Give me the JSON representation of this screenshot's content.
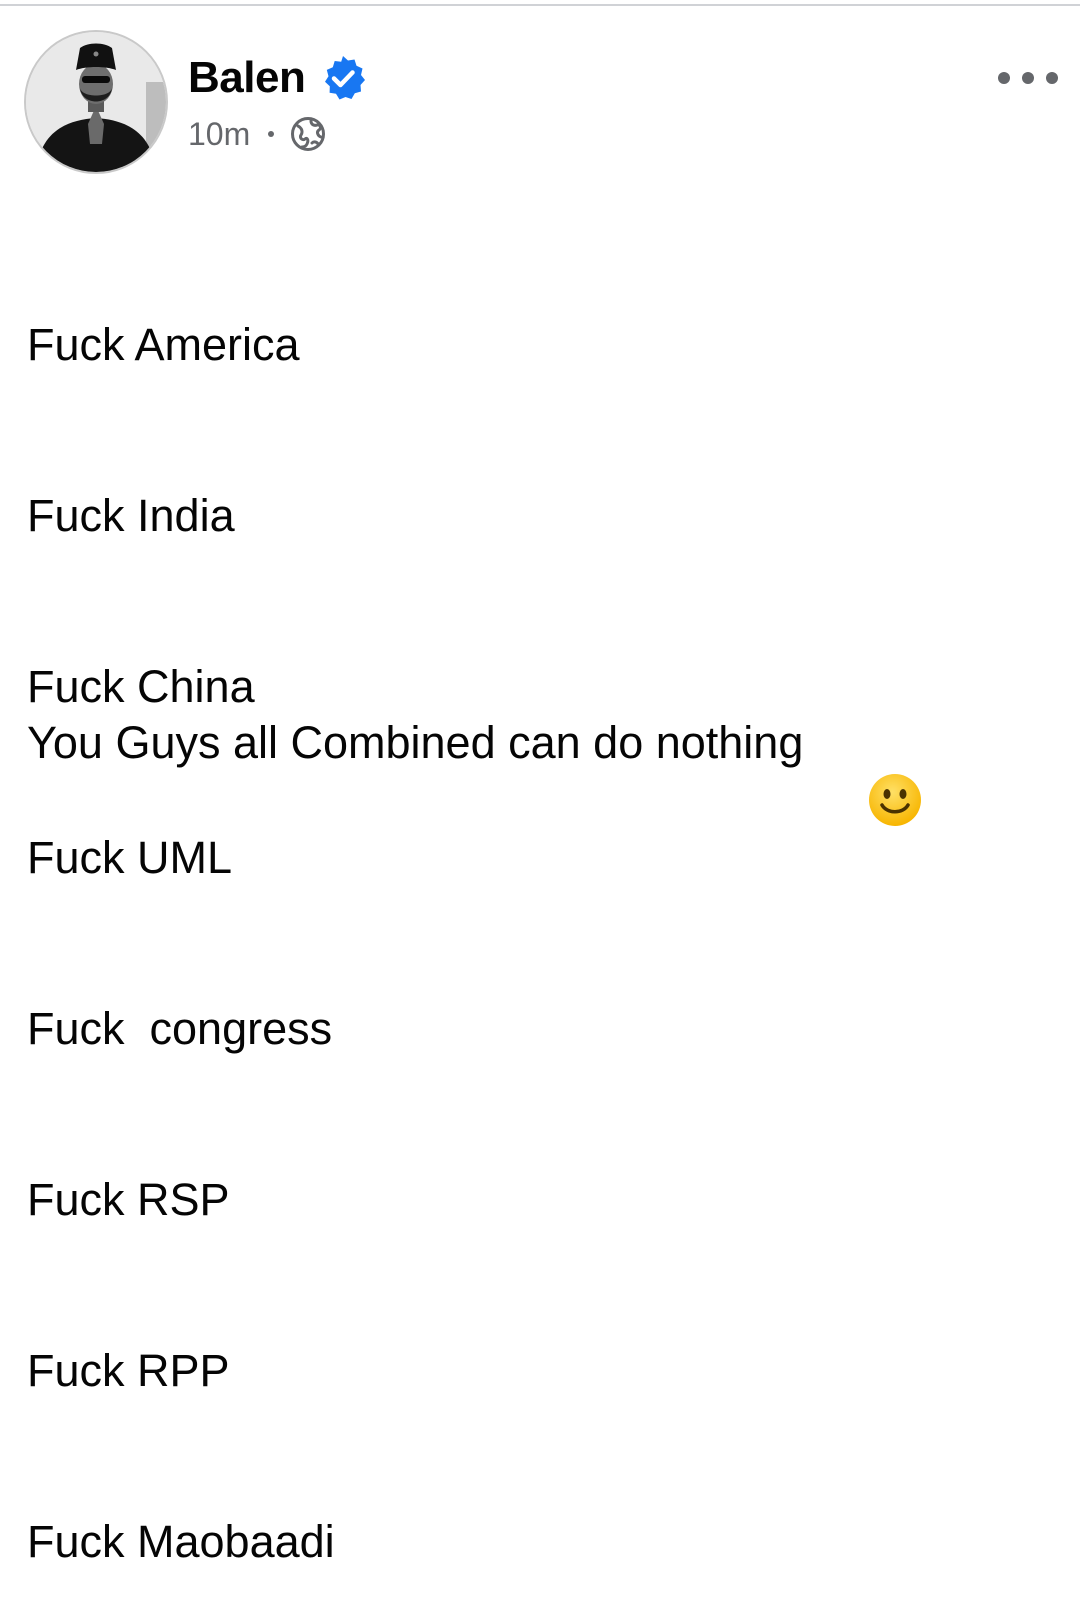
{
  "post": {
    "author": {
      "name": "Balen",
      "verified": true,
      "avatar_icon": "profile-photo"
    },
    "meta": {
      "timestamp": "10m",
      "audience_icon": "globe-icon"
    },
    "more_icon": "more-options-icon",
    "lines": [
      "Fuck America",
      "Fuck India",
      "Fuck China",
      "Fuck UML",
      "Fuck  congress",
      "Fuck RSP",
      "Fuck RPP",
      "Fuck Maobaadi"
    ],
    "closing_text": "You Guys all Combined can do nothing",
    "closing_emoji": "slightly-smiling-face-icon"
  },
  "colors": {
    "text": "#050505",
    "secondary": "#65676b",
    "verified_blue": "#1877f2",
    "emoji_yellow": "#ffcc33"
  }
}
